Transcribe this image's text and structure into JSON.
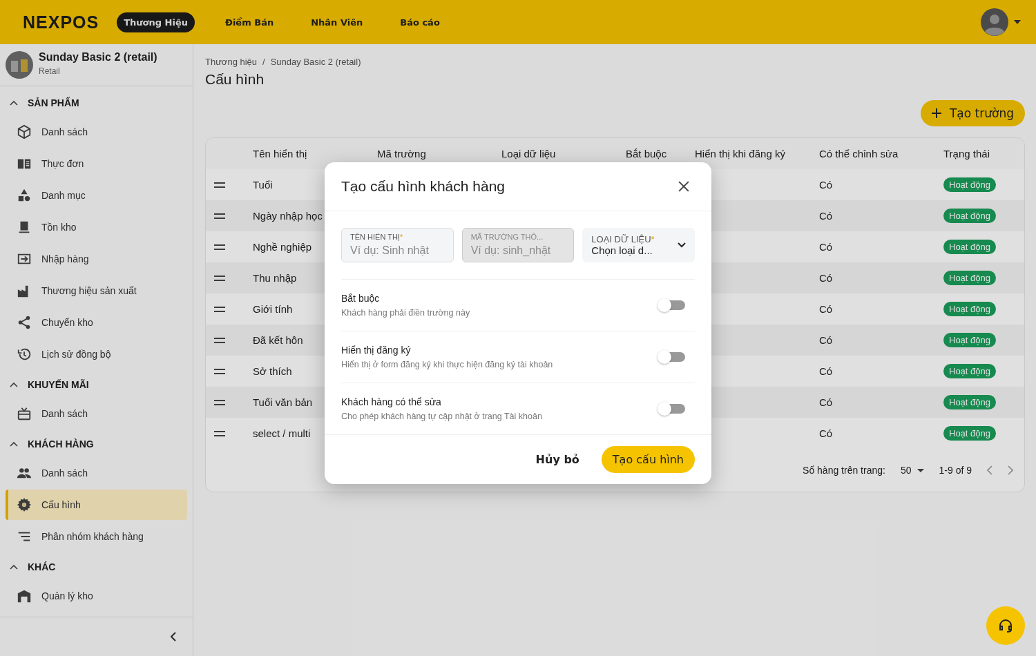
{
  "topbar": {
    "logo": "NEXPOS",
    "tabs": [
      {
        "label": "Thương Hiệu",
        "selected": true
      },
      {
        "label": "Điểm Bán",
        "selected": false
      },
      {
        "label": "Nhân Viên",
        "selected": false
      },
      {
        "label": "Báo cáo",
        "selected": false
      }
    ]
  },
  "sidebar": {
    "brand": {
      "name": "Sunday Basic 2 (retail)",
      "type": "Retail"
    },
    "sections": [
      {
        "title": "SẢN PHẨM",
        "expanded": true,
        "items": [
          {
            "label": "Danh sách",
            "selected": false
          },
          {
            "label": "Thực đơn",
            "selected": false
          },
          {
            "label": "Danh mục",
            "selected": false
          },
          {
            "label": "Tồn kho",
            "selected": false
          },
          {
            "label": "Nhập hàng",
            "selected": false
          },
          {
            "label": "Thương hiệu sản xuất",
            "selected": false
          },
          {
            "label": "Chuyển kho",
            "selected": false
          },
          {
            "label": "Lịch sử đồng bộ",
            "selected": false
          }
        ]
      },
      {
        "title": "KHUYẾN MÃI",
        "expanded": true,
        "items": [
          {
            "label": "Danh sách",
            "selected": false
          }
        ]
      },
      {
        "title": "KHÁCH HÀNG",
        "expanded": true,
        "items": [
          {
            "label": "Danh sách",
            "selected": false
          },
          {
            "label": "Cấu hình",
            "selected": true
          },
          {
            "label": "Phân nhóm khách hàng",
            "selected": false
          }
        ]
      },
      {
        "title": "KHÁC",
        "expanded": true,
        "items": [
          {
            "label": "Quản lý kho",
            "selected": false
          }
        ]
      }
    ]
  },
  "breadcrumb": {
    "separator": "/",
    "items": [
      "Thương hiệu",
      "Sunday Basic 2 (retail)"
    ]
  },
  "page_title": "Cấu hình",
  "create_button": "Tạo trường",
  "table": {
    "columns": [
      "Tên hiển thị",
      "Mã trường",
      "Loại dữ liệu",
      "Bắt buộc",
      "Hiển thị khi đăng ký",
      "Có thể chỉnh sửa",
      "Trạng thái"
    ],
    "rows": [
      {
        "name": "Tuổi",
        "editable": "Có",
        "status": "Hoạt động"
      },
      {
        "name": "Ngày nhập học",
        "editable": "Có",
        "status": "Hoạt động"
      },
      {
        "name": "Nghề nghiệp",
        "editable": "Có",
        "status": "Hoạt động"
      },
      {
        "name": "Thu nhập",
        "editable": "Có",
        "status": "Hoạt động"
      },
      {
        "name": "Giới tính",
        "editable": "Có",
        "status": "Hoạt động"
      },
      {
        "name": "Đã kết hôn",
        "editable": "Có",
        "status": "Hoạt động"
      },
      {
        "name": "Sở thích",
        "editable": "Có",
        "status": "Hoạt động"
      },
      {
        "name": "Tuổi văn bản",
        "editable": "Có",
        "status": "Hoạt động"
      },
      {
        "name": "select / multi",
        "editable": "Có",
        "status": "Hoạt động"
      }
    ],
    "pagination": {
      "label": "Số hàng trên trang:",
      "per_page": "50",
      "range": "1-9 of 9"
    }
  },
  "dialog": {
    "title": "Tạo cấu hình khách hàng",
    "required_mark": "*",
    "fields": [
      {
        "kind": "text",
        "label": "TÊN HIỂN THỊ",
        "required": true,
        "placeholder": "Ví dụ: Sinh nhật",
        "disabled": false
      },
      {
        "kind": "text",
        "label": "MÃ TRƯỜNG THÔ...",
        "required": false,
        "placeholder": "Ví dụ: sinh_nhật",
        "disabled": true
      },
      {
        "kind": "select",
        "label": "LOẠI DỮ LIỆU",
        "required": true,
        "value": "Chọn loại d..."
      }
    ],
    "toggles": [
      {
        "title": "Bắt buộc",
        "description": "Khách hàng phải điền trường này",
        "on": false
      },
      {
        "title": "Hiển thị đăng ký",
        "description": "Hiển thị ở form đăng ký khi thực hiện đăng ký tài khoản",
        "on": false
      },
      {
        "title": "Khách hàng có thể sửa",
        "description": "Cho phép khách hàng tự cập nhật ở trang Tài khoản",
        "on": false
      }
    ],
    "cancel": "Hủy bỏ",
    "submit": "Tạo cấu hình"
  }
}
